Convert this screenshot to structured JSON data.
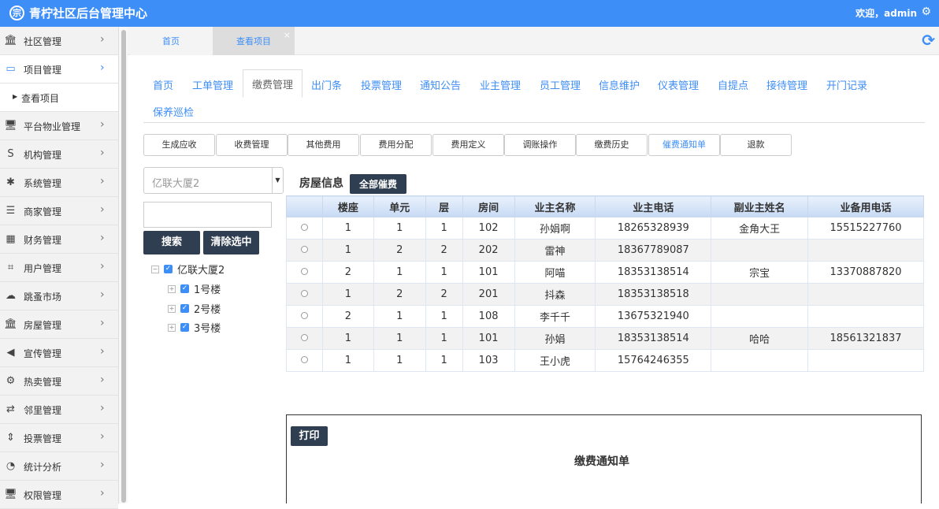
{
  "header": {
    "logo_char": "宗",
    "title": "青柠社区后台管理中心",
    "welcome": "欢迎，admin",
    "accent": "#3e8ef7"
  },
  "sidebar": {
    "items": [
      {
        "label": "社区管理",
        "icon": "bank-icon",
        "glyph": "🏛"
      },
      {
        "label": "项目管理",
        "icon": "project-icon",
        "glyph": "▭"
      },
      {
        "label": "平台物业管理",
        "icon": "monitor-icon",
        "glyph": "🖥"
      },
      {
        "label": "机构管理",
        "icon": "stripe-icon",
        "glyph": "S"
      },
      {
        "label": "系统管理",
        "icon": "yelp-icon",
        "glyph": "✱"
      },
      {
        "label": "商家管理",
        "icon": "bars-icon",
        "glyph": "☰"
      },
      {
        "label": "财务管理",
        "icon": "calculator-icon",
        "glyph": "▦"
      },
      {
        "label": "用户管理",
        "icon": "crop-icon",
        "glyph": "⌗"
      },
      {
        "label": "跳蚤市场",
        "icon": "cloud-icon",
        "glyph": "☁"
      },
      {
        "label": "房屋管理",
        "icon": "bank-icon",
        "glyph": "🏛"
      },
      {
        "label": "宣传管理",
        "icon": "volume-icon",
        "glyph": "◀"
      },
      {
        "label": "热卖管理",
        "icon": "gear-icon",
        "glyph": "⚙"
      },
      {
        "label": "邻里管理",
        "icon": "retweet-icon",
        "glyph": "⇄"
      },
      {
        "label": "投票管理",
        "icon": "sort-icon",
        "glyph": "⇕"
      },
      {
        "label": "统计分析",
        "icon": "pie-chart-icon",
        "glyph": "◔"
      },
      {
        "label": "权限管理",
        "icon": "monitor-icon",
        "glyph": "🖥"
      }
    ],
    "sub_item": "查看项目"
  },
  "tabs": {
    "home": "首页",
    "current": "查看项目",
    "close": "×"
  },
  "nav": [
    "首页",
    "工单管理",
    "缴费管理",
    "出门条",
    "投票管理",
    "通知公告",
    "业主管理",
    "员工管理",
    "信息维护",
    "仪表管理",
    "自提点",
    "接待管理",
    "开门记录",
    "保养巡检"
  ],
  "subnav": [
    "生成应收",
    "收费管理",
    "其他费用",
    "费用分配",
    "费用定义",
    "调账操作",
    "缴费历史",
    "催费通知单",
    "退款"
  ],
  "filter": {
    "building_select": "亿联大厦2",
    "search_value": "",
    "search_btn": "搜索",
    "clear_btn": "清除选中"
  },
  "tree": {
    "root": "亿联大厦2",
    "children": [
      "1号楼",
      "2号楼",
      "3号楼"
    ]
  },
  "house": {
    "title": "房屋信息",
    "all_btn": "全部催费"
  },
  "table": {
    "headers": [
      "楼座",
      "单元",
      "层",
      "房间",
      "业主名称",
      "业主电话",
      "副业主姓名",
      "业备用电话"
    ],
    "rows": [
      [
        "1",
        "1",
        "1",
        "102",
        "孙娟啊",
        "18265328939",
        "金角大王",
        "15515227760"
      ],
      [
        "1",
        "2",
        "2",
        "202",
        "雷神",
        "18367789087",
        "",
        ""
      ],
      [
        "2",
        "1",
        "1",
        "101",
        "阿喵",
        "18353138514",
        "宗宝",
        "13370887820"
      ],
      [
        "1",
        "2",
        "2",
        "201",
        "抖森",
        "18353138518",
        "",
        ""
      ],
      [
        "2",
        "1",
        "1",
        "108",
        "李千千",
        "13675321940",
        "",
        ""
      ],
      [
        "1",
        "1",
        "1",
        "101",
        "孙娟",
        "18353138514",
        "哈哈",
        "18561321837"
      ],
      [
        "1",
        "1",
        "1",
        "103",
        "王小虎",
        "15764246355",
        "",
        ""
      ]
    ]
  },
  "print": {
    "btn": "打印",
    "title": "缴费通知单"
  }
}
